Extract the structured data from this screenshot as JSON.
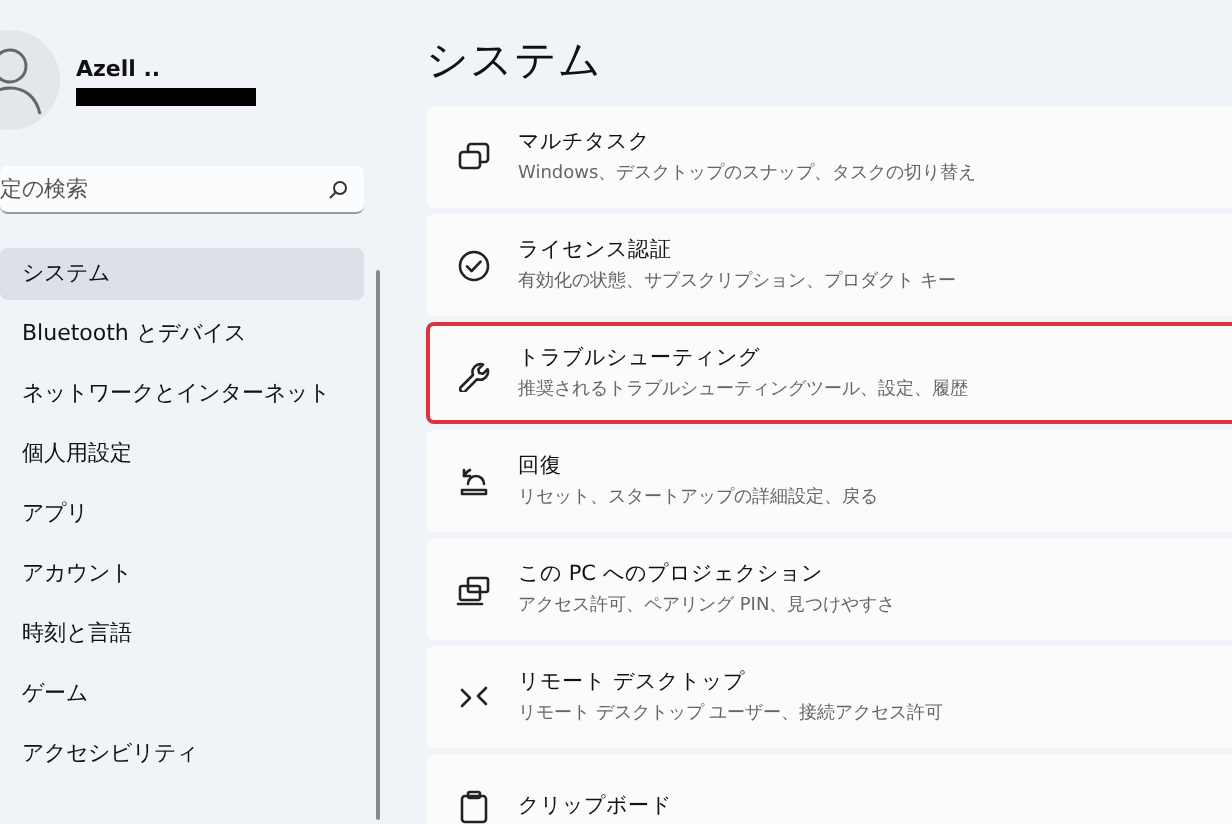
{
  "account": {
    "name": "Azell .."
  },
  "search": {
    "placeholder": "定の検索"
  },
  "nav": [
    {
      "label": "システム",
      "selected": true
    },
    {
      "label": "Bluetooth とデバイス",
      "selected": false
    },
    {
      "label": "ネットワークとインターネット",
      "selected": false
    },
    {
      "label": "個人用設定",
      "selected": false
    },
    {
      "label": "アプリ",
      "selected": false
    },
    {
      "label": "アカウント",
      "selected": false
    },
    {
      "label": "時刻と言語",
      "selected": false
    },
    {
      "label": "ゲーム",
      "selected": false
    },
    {
      "label": "アクセシビリティ",
      "selected": false
    }
  ],
  "page": {
    "title": "システム"
  },
  "settings": [
    {
      "kind": "multitask",
      "title": "マルチタスク",
      "subtitle": "Windows、デスクトップのスナップ、タスクの切り替え",
      "highlighted": false
    },
    {
      "kind": "activation",
      "title": "ライセンス認証",
      "subtitle": "有効化の状態、サブスクリプション、プロダクト キー",
      "highlighted": false
    },
    {
      "kind": "troubleshoot",
      "title": "トラブルシューティング",
      "subtitle": "推奨されるトラブルシューティングツール、設定、履歴",
      "highlighted": true
    },
    {
      "kind": "recovery",
      "title": "回復",
      "subtitle": "リセット、スタートアップの詳細設定、戻る",
      "highlighted": false
    },
    {
      "kind": "projection",
      "title": "この PC へのプロジェクション",
      "subtitle": "アクセス許可、ペアリング PIN、見つけやすさ",
      "highlighted": false
    },
    {
      "kind": "remote",
      "title": "リモート デスクトップ",
      "subtitle": "リモート デスクトップ ユーザー、接続アクセス許可",
      "highlighted": false
    },
    {
      "kind": "clipboard",
      "title": "クリップボード",
      "highlighted": false
    }
  ]
}
